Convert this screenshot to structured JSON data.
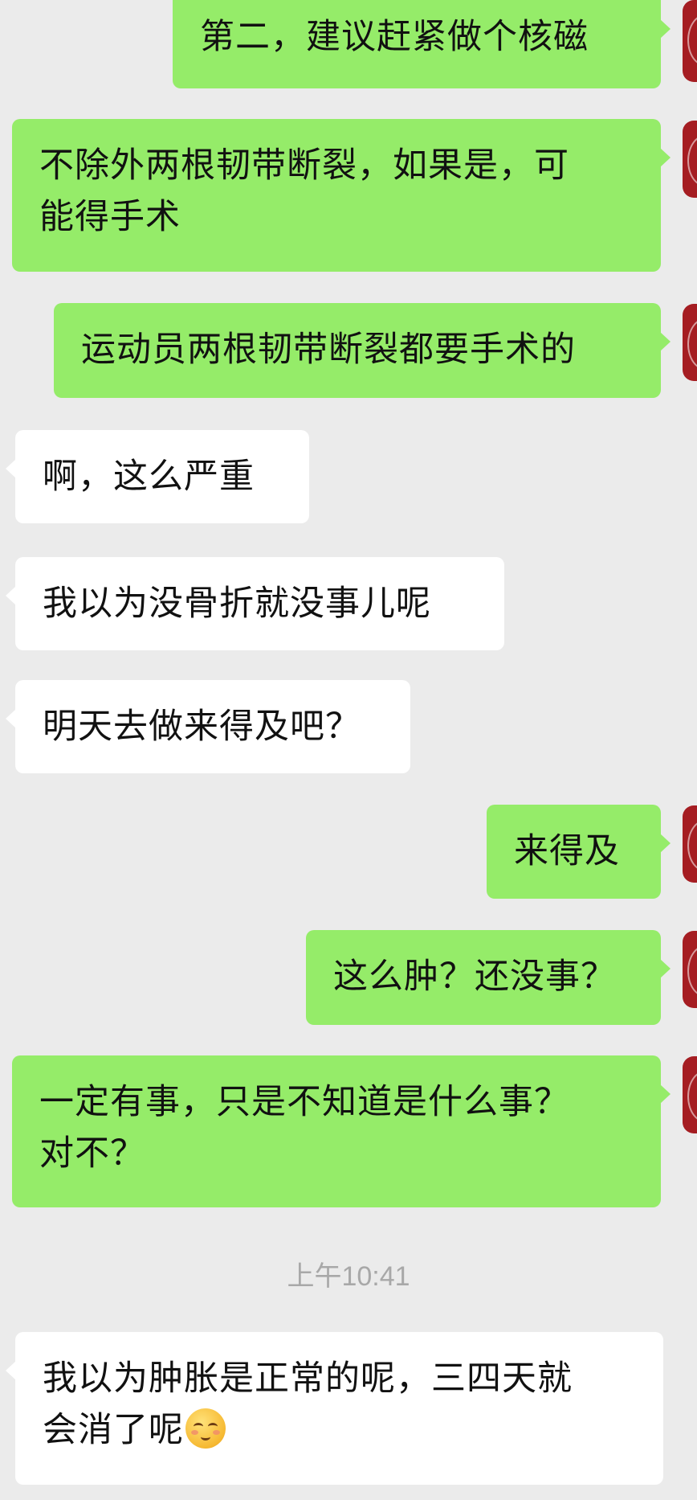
{
  "messages": [
    {
      "side": "out",
      "text": "第二，建议赶紧做个核磁"
    },
    {
      "side": "out",
      "line1": "不除外两根韧带断裂，如果是，可",
      "line2": "能得手术"
    },
    {
      "side": "out",
      "text": "运动员两根韧带断裂都要手术的"
    },
    {
      "side": "in",
      "text": "啊，这么严重"
    },
    {
      "side": "in",
      "text": "我以为没骨折就没事儿呢"
    },
    {
      "side": "in",
      "text": "明天去做来得及吧？"
    },
    {
      "side": "out",
      "text": "来得及"
    },
    {
      "side": "out",
      "text": "这么肿？还没事？"
    },
    {
      "side": "out",
      "line1": "一定有事，只是不知道是什么事？",
      "line2": "对不？"
    },
    {
      "side": "in",
      "line1": "我以为肿胀是正常的呢，三四天就",
      "line2": "会消了呢",
      "emoji": "relieved-face-emoji"
    }
  ],
  "timestamp": "上午10:41",
  "colors": {
    "background": "#ebebeb",
    "outgoing_bubble": "#95ec69",
    "incoming_bubble": "#ffffff",
    "avatar": "#a51d22",
    "timestamp_text": "#a8a8a8"
  }
}
